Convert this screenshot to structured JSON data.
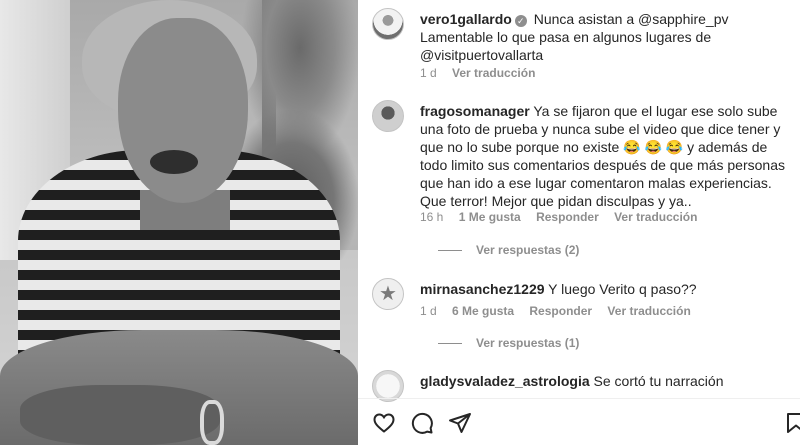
{
  "comments": [
    {
      "username": "vero1gallardo",
      "verified": true,
      "text": "Nunca asistan a @sapphire_pv Lamentable lo que pasa en algunos lugares de @visitpuertovallarta",
      "time": "1 d",
      "translate": "Ver traducción"
    },
    {
      "username": "fragosomanager",
      "verified": false,
      "text": "Ya se fijaron que el lugar ese solo sube una foto de prueba y nunca sube el video que dice tener y que no lo sube porque no existe 😂 😂 😂 y además de todo limito sus comentarios después de que más personas que han ido a ese lugar comentaron malas experiencias. Que terror! Mejor que pidan disculpas y ya..",
      "time": "16 h",
      "likes": "1 Me gusta",
      "reply": "Responder",
      "translate": "Ver traducción",
      "replies": "Ver respuestas (2)"
    },
    {
      "username": "mirnasanchez1229",
      "verified": false,
      "text": "Y luego Verito q paso??",
      "time": "1 d",
      "likes": "6 Me gusta",
      "reply": "Responder",
      "translate": "Ver traducción",
      "replies": "Ver respuestas (1)"
    },
    {
      "username": "gladysvaladez_astrologia",
      "verified": false,
      "text": "Se cortó tu narración"
    }
  ],
  "icons": {
    "like": "heart-icon",
    "comment": "comment-icon",
    "share": "send-icon",
    "save": "bookmark-icon"
  }
}
